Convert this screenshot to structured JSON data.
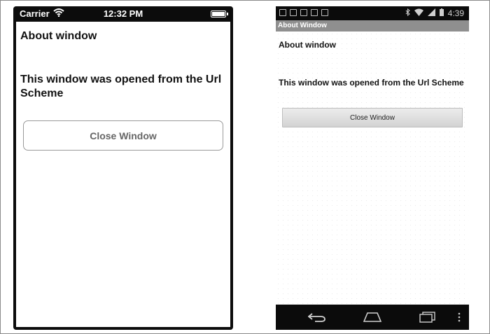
{
  "ios": {
    "status": {
      "carrier": "Carrier",
      "time": "12:32 PM"
    },
    "title": "About window",
    "message": "This window was opened from the Url Scheme",
    "close_button": "Close Window"
  },
  "android": {
    "status": {
      "time": "4:39"
    },
    "title_bar": "About Window",
    "heading": "About window",
    "message": "This window was opened from the Url Scheme",
    "close_button": "Close Window",
    "nav": {
      "back": "back-icon",
      "home": "home-icon",
      "recents": "recents-icon",
      "menu": "overflow-menu-icon"
    }
  }
}
